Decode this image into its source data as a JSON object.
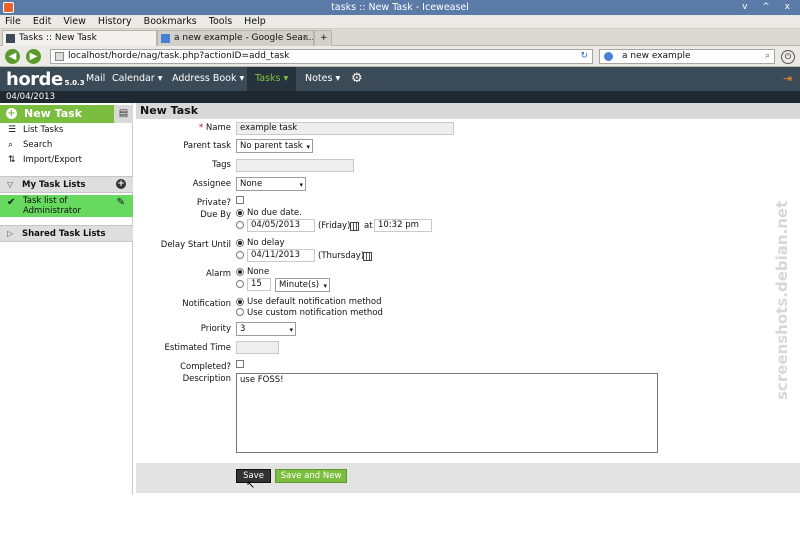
{
  "window": {
    "title": "tasks :: New Task - Iceweasel",
    "controls": "v ^ x"
  },
  "menubar": [
    "File",
    "Edit",
    "View",
    "History",
    "Bookmarks",
    "Tools",
    "Help"
  ],
  "tabs": [
    {
      "label": "Tasks :: New Task",
      "close": "x"
    },
    {
      "label": "a new example - Google Sear...",
      "close": "x"
    },
    {
      "label": "+"
    }
  ],
  "nav": {
    "back": "◀",
    "forward": "▶",
    "url": "localhost/horde/nag/task.php?actionID=add_task",
    "search": "a new example"
  },
  "appbar": {
    "logo": "horde",
    "version": "5.0.3",
    "menus": [
      "Mail",
      "Calendar ▾",
      "Address Book ▾",
      "Tasks ▾",
      "Notes ▾"
    ],
    "date": "04/04/2013"
  },
  "sidebar": {
    "new_task": "New Task",
    "items": [
      "List Tasks",
      "Search",
      "Import/Export"
    ],
    "my_task_lists": "My Task Lists",
    "task_list": "Task list of Administrator",
    "shared": "Shared Task Lists"
  },
  "form": {
    "page_title": "New Task",
    "labels": {
      "name": "Name",
      "parent": "Parent task",
      "tags": "Tags",
      "assignee": "Assignee",
      "private": "Private?",
      "due": "Due By",
      "delay": "Delay Start Until",
      "alarm": "Alarm",
      "notification": "Notification",
      "priority": "Priority",
      "estimated": "Estimated Time",
      "completed": "Completed?",
      "description": "Description"
    },
    "required_marker": "*",
    "name_value": "example task",
    "parent_value": "No parent task",
    "assignee_value": "None",
    "due": {
      "none": "No due date.",
      "date": "04/05/2013",
      "day": "(Friday)",
      "at": "at",
      "time": "10:32 pm"
    },
    "delay": {
      "none": "No delay",
      "date": "04/11/2013",
      "day": "(Thursday)"
    },
    "alarm": {
      "none": "None",
      "amount": "15",
      "unit": "Minute(s)"
    },
    "notification": {
      "default": "Use default notification method",
      "custom": "Use custom notification method"
    },
    "priority_value": "3",
    "description_value": "use FOSS!",
    "save": "Save",
    "save_new": "Save and New"
  },
  "watermark": "screenshots.debian.net",
  "colors": {
    "accent": "#7bbd3e",
    "appbar": "#3a4a57",
    "tasklist": "#67d95e"
  }
}
